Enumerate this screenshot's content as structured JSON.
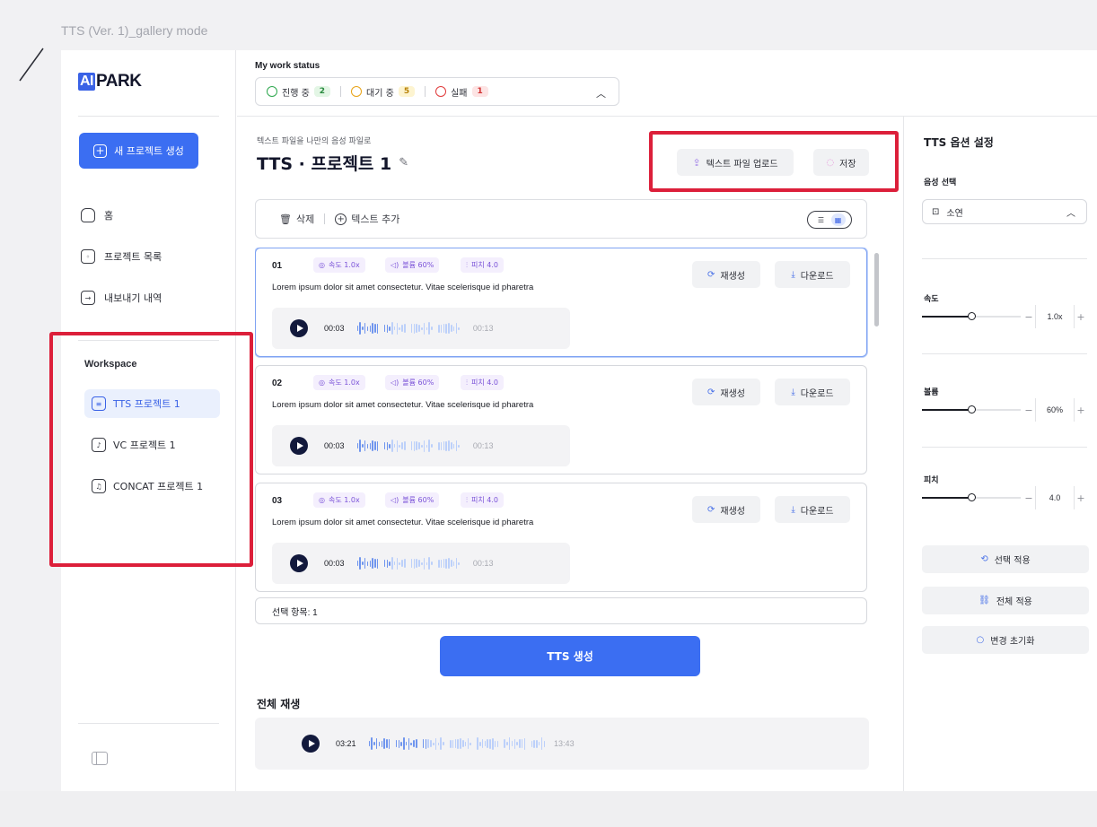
{
  "frame_title": "TTS (Ver. 1)_gallery mode",
  "sidebar": {
    "logo_ai": "AI",
    "logo_park": "PARK",
    "new_project": "새 프로젝트 생성",
    "nav": [
      {
        "label": "홈",
        "icon": "home-icon"
      },
      {
        "label": "프로젝트 목록",
        "icon": "folder-icon"
      },
      {
        "label": "내보내기 내역",
        "icon": "export-icon"
      }
    ],
    "workspace_label": "Workspace",
    "workspace_items": [
      {
        "label": "TTS 프로젝트 1",
        "icon": "document-icon",
        "active": true
      },
      {
        "label": "VC 프로젝트 1",
        "icon": "voice-file-icon"
      },
      {
        "label": "CONCAT 프로젝트 1",
        "icon": "music-file-icon"
      }
    ]
  },
  "status": {
    "title": "My work status",
    "in_progress_label": "진행 중",
    "in_progress_count": "2",
    "waiting_label": "대기 중",
    "waiting_count": "5",
    "failed_label": "실패",
    "failed_count": "1",
    "colors": {
      "progress": "#2fa84f",
      "waiting": "#e8a317",
      "failed": "#e03b3b"
    }
  },
  "main": {
    "subtitle": "텍스트 파일을 나만의 음성 파일로",
    "title": "TTS · 프로젝트 1",
    "upload_label": "텍스트 파일 업로드",
    "save_label": "저장",
    "delete_label": "삭제",
    "add_text_label": "텍스트 추가",
    "cards": [
      {
        "num": "01",
        "speed": "속도 1.0x",
        "volume": "볼륨 60%",
        "pitch": "피치 4.0",
        "text": "Lorem ipsum dolor sit amet consectetur. Vitae scelerisque id pharetra",
        "regen": "재생성",
        "download": "다운로드",
        "current": "00:03",
        "total": "00:13"
      },
      {
        "num": "02",
        "speed": "속도 1.0x",
        "volume": "볼륨 60%",
        "pitch": "피치 4.0",
        "text": "Lorem ipsum dolor sit amet consectetur. Vitae scelerisque id pharetra",
        "regen": "재생성",
        "download": "다운로드",
        "current": "00:03",
        "total": "00:13"
      },
      {
        "num": "03",
        "speed": "속도 1.0x",
        "volume": "볼륨 60%",
        "pitch": "피치 4.0",
        "text": "Lorem ipsum dolor sit amet consectetur. Vitae scelerisque id pharetra",
        "regen": "재생성",
        "download": "다운로드",
        "current": "00:03",
        "total": "00:13"
      }
    ],
    "selected_count": "선택 항목: 1",
    "generate_label": "TTS 생성",
    "play_all_title": "전체 재생",
    "all_current": "03:21",
    "all_total": "13:43"
  },
  "options": {
    "title": "TTS 옵션 설정",
    "voice_label": "음성 선택",
    "voice_value": "소연",
    "speed_label": "속도",
    "speed_value": "1.0x",
    "speed_level": 0.5,
    "volume_label": "볼륨",
    "volume_value": "60%",
    "volume_level": 0.5,
    "pitch_label": "피치",
    "pitch_value": "4.0",
    "pitch_level": 0.5,
    "apply_selected": "선택 적용",
    "apply_all": "전체 적용",
    "reset": "변경 초기화"
  }
}
